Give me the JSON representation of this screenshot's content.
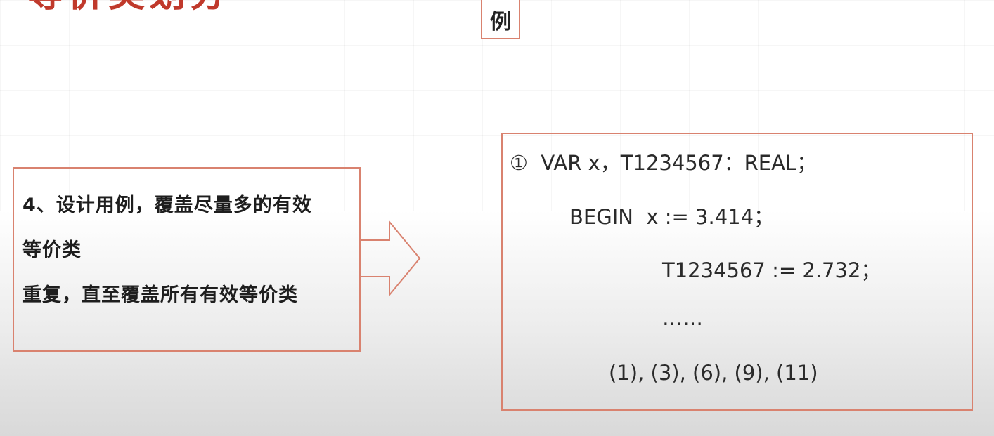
{
  "header": {
    "title": "等价类划分",
    "example_label": "例"
  },
  "step": {
    "line1": "4、设计用例，覆盖尽量多的有效",
    "line2": "等价类",
    "line3": "重复，直至覆盖所有有效等价类"
  },
  "example": {
    "line1": "①  VAR x，T1234567：REAL；",
    "line2": "BEGIN  x := 3.414；",
    "line3": "T1234567 := 2.732；",
    "line4": "……",
    "covered": "(1), (3), (6), (9), (11)"
  },
  "colors": {
    "accent": "#d9826f",
    "title": "#c0392b"
  },
  "icons": {
    "arrow": "right-arrow-icon"
  }
}
